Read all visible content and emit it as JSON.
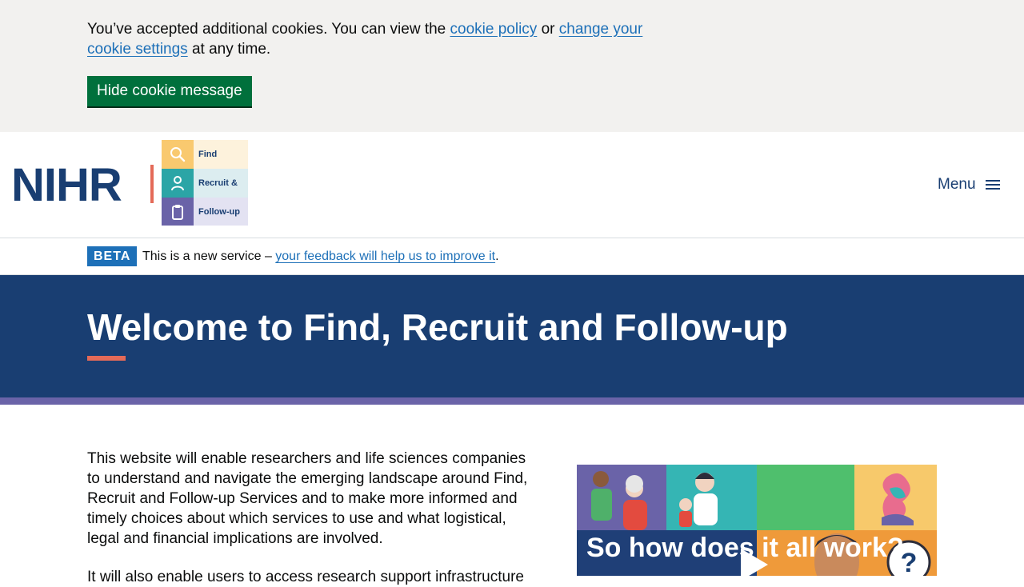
{
  "cookie_banner": {
    "text_before": "You’ve accepted additional cookies. You can view the ",
    "link_policy": "cookie policy",
    "text_or": " or ",
    "link_settings": "change your cookie settings",
    "text_after": " at any time.",
    "hide_button": "Hide cookie message"
  },
  "header": {
    "org_wordmark": "NIHR",
    "service_logo_rows": [
      "Find",
      "Recruit &",
      "Follow-up"
    ],
    "menu_label": "Menu"
  },
  "beta": {
    "tag": "BETA",
    "text": "This is a new service – ",
    "link": "your feedback will help us to improve it",
    "suffix": "."
  },
  "hero": {
    "title": "Welcome to Find, Recruit and Follow-up"
  },
  "main": {
    "intro": "This website will enable researchers and life sciences companies to understand and navigate the emerging landscape around Find, Recruit and Follow-up Services and to make more informed and timely choices about which services to use and what logistical, legal and financial implications are involved.",
    "intro2_partial": "It will also enable users to access research support infrastructure",
    "video_title": "So how does it all work?"
  },
  "colors": {
    "cookie_bg": "#f2f1ef",
    "button_green": "#00703c",
    "link_blue": "#1d70b8",
    "nihr_navy": "#193e72",
    "accent_coral": "#e46a58",
    "stripe_purple": "#6a63a8"
  },
  "icons": [
    "search-icon",
    "person-icon",
    "clipboard-icon",
    "hamburger-icon",
    "play-icon"
  ]
}
